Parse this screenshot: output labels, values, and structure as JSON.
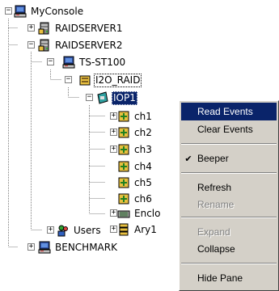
{
  "tree": {
    "root": "MyConsole",
    "server1": "RAIDSERVER1",
    "server2": "RAIDSERVER2",
    "ts": "TS-ST100",
    "i2o": "I2O_RAID",
    "iop": "IOP1",
    "channels": [
      "ch1",
      "ch2",
      "ch3",
      "ch4",
      "ch5",
      "ch6"
    ],
    "enclosure": "Enclo",
    "array": "Ary1",
    "users": "Users",
    "benchmark": "BENCHMARK"
  },
  "context_menu": {
    "read_events": "Read Events",
    "clear_events": "Clear Events",
    "beeper": "Beeper",
    "refresh": "Refresh",
    "rename": "Rename",
    "expand": "Expand",
    "collapse": "Collapse",
    "hide_pane": "Hide Pane"
  },
  "colors": {
    "selection": "#0a246a",
    "menu_face": "#d4d0c8",
    "disabled_text": "#808080"
  }
}
